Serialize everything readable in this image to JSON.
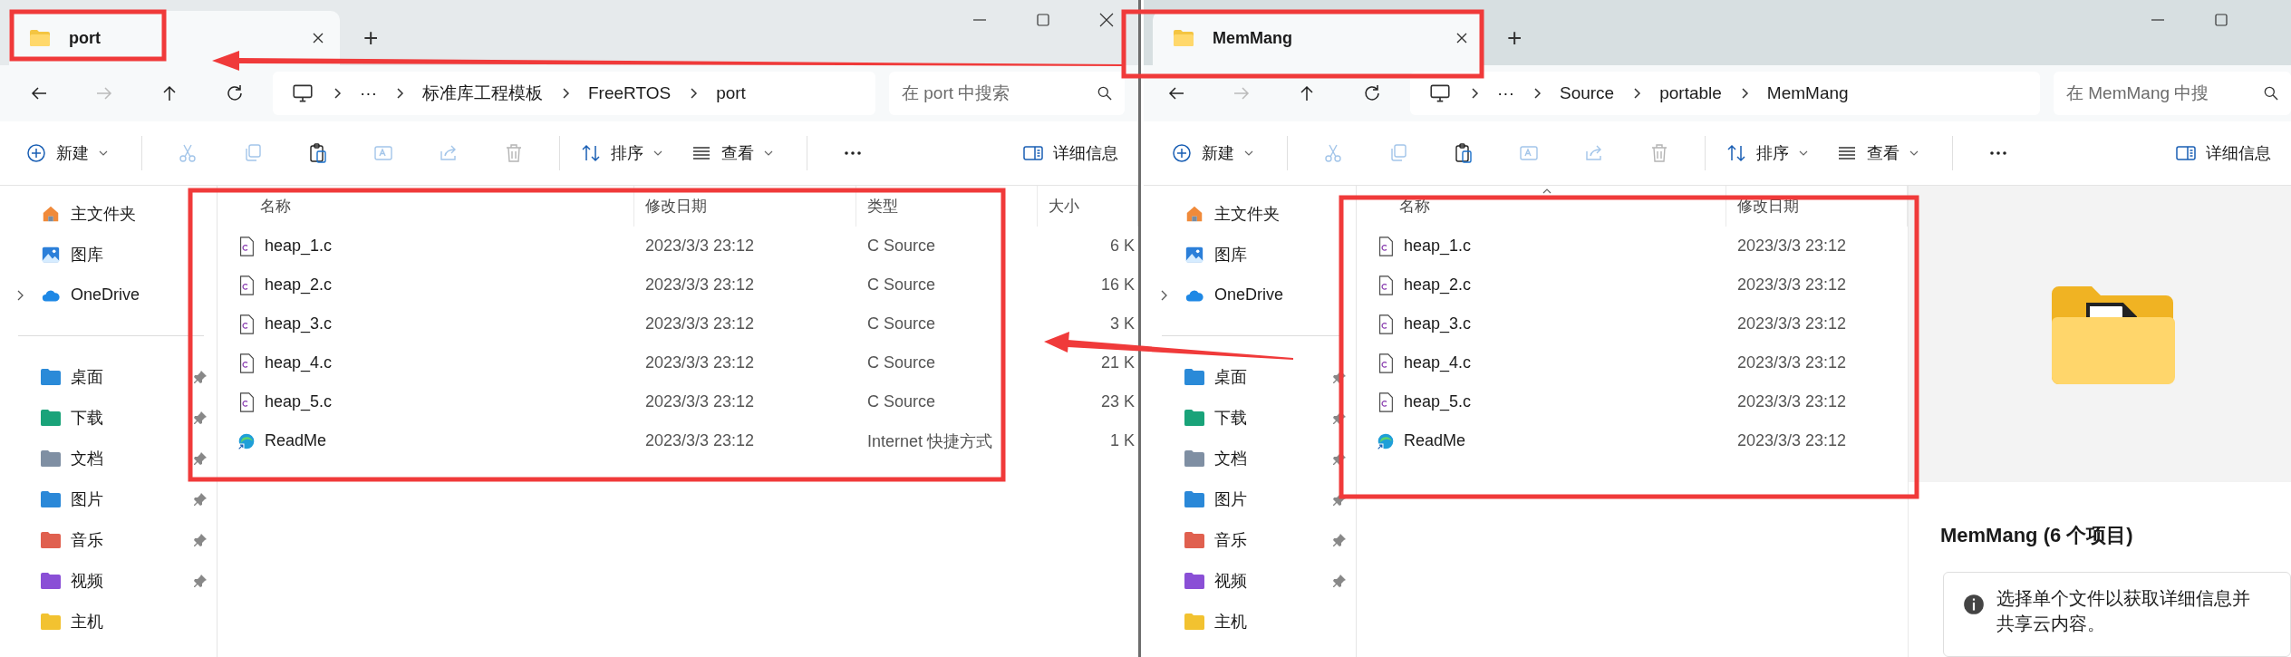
{
  "windows": [
    {
      "tab": {
        "title": "port",
        "selected": true
      },
      "new_tab": "+",
      "caption_buttons": [
        {
          "kind": "minimize"
        },
        {
          "kind": "maximize"
        },
        {
          "kind": "close"
        }
      ],
      "breadcrumb": {
        "overflow": "···",
        "items": [
          "标准库工程模板",
          "FreeRTOS",
          "port"
        ]
      },
      "search": {
        "placeholder": "在 port 中搜索"
      },
      "toolbar": {
        "new": "新建",
        "actions": [
          {
            "kind": "cut",
            "disabled": true
          },
          {
            "kind": "copy",
            "disabled": true
          },
          {
            "kind": "paste",
            "disabled": false
          },
          {
            "kind": "rename",
            "disabled": true
          },
          {
            "kind": "share",
            "disabled": true
          },
          {
            "kind": "delete",
            "disabled": true
          }
        ],
        "sort": "排序",
        "view": "查看",
        "details": "详细信息"
      },
      "sidebar": {
        "top": [
          {
            "label": "主文件夹",
            "expandable": false
          },
          {
            "label": "图库",
            "expandable": false
          },
          {
            "label": "OneDrive",
            "expandable": true
          }
        ],
        "quick": [
          {
            "label": "桌面",
            "pinned": true
          },
          {
            "label": "下载",
            "pinned": true
          },
          {
            "label": "文档",
            "pinned": true
          },
          {
            "label": "图片",
            "pinned": true
          },
          {
            "label": "音乐",
            "pinned": true
          },
          {
            "label": "视频",
            "pinned": true
          },
          {
            "label": "主机",
            "pinned": false
          }
        ]
      },
      "columns": [
        {
          "label": "名称",
          "sorted": false
        },
        {
          "label": "修改日期",
          "sorted": false
        },
        {
          "label": "类型",
          "sorted": false
        },
        {
          "label": "大小",
          "sorted": false
        }
      ],
      "rows": [
        {
          "kind": "c-source",
          "name": "heap_1.c",
          "modified": "2023/3/3 23:12",
          "type": "C Source",
          "size": "6 K"
        },
        {
          "kind": "c-source",
          "name": "heap_2.c",
          "modified": "2023/3/3 23:12",
          "type": "C Source",
          "size": "16 K"
        },
        {
          "kind": "c-source",
          "name": "heap_3.c",
          "modified": "2023/3/3 23:12",
          "type": "C Source",
          "size": "3 K"
        },
        {
          "kind": "c-source",
          "name": "heap_4.c",
          "modified": "2023/3/3 23:12",
          "type": "C Source",
          "size": "21 K"
        },
        {
          "kind": "c-source",
          "name": "heap_5.c",
          "modified": "2023/3/3 23:12",
          "type": "C Source",
          "size": "23 K"
        },
        {
          "kind": "shortcut",
          "name": "ReadMe",
          "modified": "2023/3/3 23:12",
          "type": "Internet 快捷方式",
          "size": "1 K"
        }
      ]
    },
    {
      "tab": {
        "title": "MemMang",
        "selected": true
      },
      "new_tab": "+",
      "caption_buttons": [
        {
          "kind": "minimize"
        },
        {
          "kind": "maximize"
        }
      ],
      "breadcrumb": {
        "overflow": "···",
        "items": [
          "Source",
          "portable",
          "MemMang"
        ]
      },
      "search": {
        "placeholder": "在 MemMang 中搜"
      },
      "toolbar": {
        "new": "新建",
        "actions": [
          {
            "kind": "cut",
            "disabled": true
          },
          {
            "kind": "copy",
            "disabled": true
          },
          {
            "kind": "paste",
            "disabled": false
          },
          {
            "kind": "rename",
            "disabled": true
          },
          {
            "kind": "share",
            "disabled": true
          },
          {
            "kind": "delete",
            "disabled": true
          }
        ],
        "sort": "排序",
        "view": "查看",
        "details": "详细信息"
      },
      "sidebar": {
        "top": [
          {
            "label": "主文件夹",
            "expandable": false
          },
          {
            "label": "图库",
            "expandable": false
          },
          {
            "label": "OneDrive",
            "expandable": true
          }
        ],
        "quick": [
          {
            "label": "桌面",
            "pinned": true
          },
          {
            "label": "下载",
            "pinned": true
          },
          {
            "label": "文档",
            "pinned": true
          },
          {
            "label": "图片",
            "pinned": true
          },
          {
            "label": "音乐",
            "pinned": true
          },
          {
            "label": "视频",
            "pinned": true
          },
          {
            "label": "主机",
            "pinned": false
          }
        ]
      },
      "columns": [
        {
          "label": "名称",
          "sorted": true
        },
        {
          "label": "修改日期",
          "sorted": false
        }
      ],
      "rows": [
        {
          "kind": "c-source",
          "name": "heap_1.c",
          "modified": "2023/3/3 23:12"
        },
        {
          "kind": "c-source",
          "name": "heap_2.c",
          "modified": "2023/3/3 23:12"
        },
        {
          "kind": "c-source",
          "name": "heap_3.c",
          "modified": "2023/3/3 23:12"
        },
        {
          "kind": "c-source",
          "name": "heap_4.c",
          "modified": "2023/3/3 23:12"
        },
        {
          "kind": "c-source",
          "name": "heap_5.c",
          "modified": "2023/3/3 23:12"
        },
        {
          "kind": "shortcut",
          "name": "ReadMe",
          "modified": "2023/3/3 23:12"
        }
      ],
      "details_pane": {
        "title": "MemMang (6 个项目)",
        "info": "选择单个文件以获取详细信息并共享云内容。"
      }
    }
  ]
}
